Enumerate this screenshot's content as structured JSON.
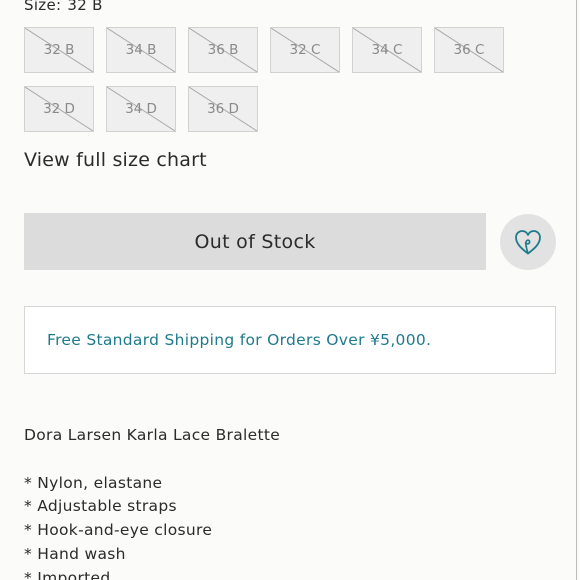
{
  "size_selector": {
    "label": "Size:",
    "selected": "32 B",
    "options_row1": [
      "32 B",
      "34 B",
      "36 B",
      "32 C",
      "34 C",
      "36 C"
    ],
    "options_row2": [
      "32 D",
      "34 D",
      "36 D"
    ],
    "options_state": "unavailable"
  },
  "size_chart_link": "View full size chart",
  "purchase": {
    "button_label": "Out of Stock",
    "wishlist_icon": "heart-outline-icon"
  },
  "shipping_notice": "Free Standard Shipping for Orders Over ¥5,000.",
  "description": {
    "product_name": "Dora Larsen Karla Lace Bralette",
    "features": [
      "* Nylon, elastane",
      "* Adjustable straps",
      "* Hook-and-eye closure",
      "* Hand wash",
      "* Imported"
    ]
  },
  "colors": {
    "accent": "#1f7a8c",
    "disabled_button": "#dcdcdc",
    "page_bg": "#fbfbf9"
  }
}
